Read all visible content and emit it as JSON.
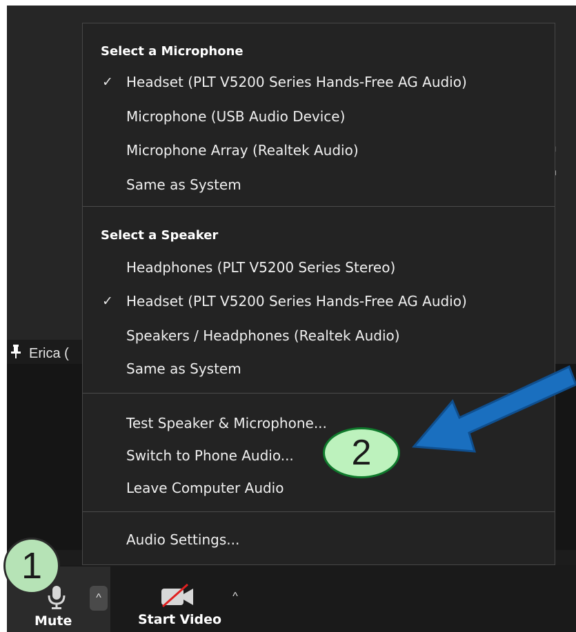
{
  "background": {
    "title_fragment": "t"
  },
  "participant": {
    "name_visible": "Erica ("
  },
  "menu": {
    "microphone_header": "Select a Microphone",
    "microphones": [
      {
        "label": "Headset (PLT V5200 Series Hands-Free AG Audio)",
        "checked": true
      },
      {
        "label": "Microphone (USB Audio Device)",
        "checked": false
      },
      {
        "label": "Microphone Array (Realtek Audio)",
        "checked": false
      },
      {
        "label": "Same as System",
        "checked": false
      }
    ],
    "speaker_header": "Select a Speaker",
    "speakers": [
      {
        "label": "Headphones (PLT V5200 Series Stereo)",
        "checked": false
      },
      {
        "label": "Headset (PLT V5200 Series Hands-Free AG Audio)",
        "checked": true
      },
      {
        "label": "Speakers / Headphones (Realtek Audio)",
        "checked": false
      },
      {
        "label": "Same as System",
        "checked": false
      }
    ],
    "actions": [
      {
        "label": "Test Speaker & Microphone..."
      },
      {
        "label": "Switch to Phone Audio..."
      },
      {
        "label": "Leave Computer Audio"
      }
    ],
    "settings": {
      "label": "Audio Settings..."
    },
    "check_glyph": "✓"
  },
  "toolbar": {
    "mute_label": "Mute",
    "video_label": "Start Video",
    "caret_glyph": "^",
    "mic_icon": "microphone-icon",
    "video_icon": "video-off-icon"
  },
  "annotations": {
    "badge_1": "1",
    "badge_2": "2",
    "arrow_color": "#1a6fbf",
    "badge_color": "#bdf2bd"
  }
}
